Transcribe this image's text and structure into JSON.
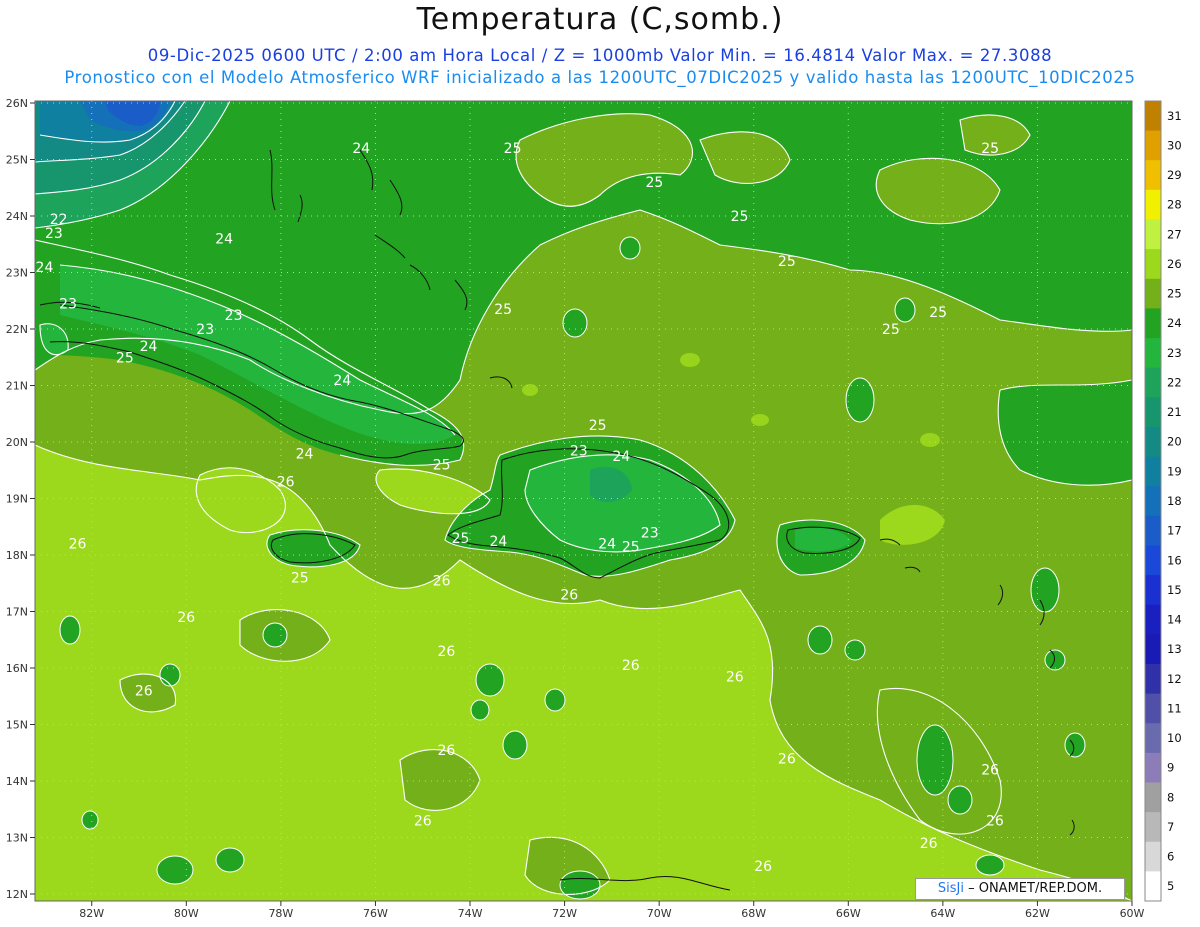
{
  "header": {
    "title": "Temperatura (C,somb.)",
    "line1": "09-Dic-2025  0600 UTC / 2:00 am Hora Local / Z = 1000mb   Valor Min. = 16.4814  Valor Max. = 27.3088",
    "line2": "Pronostico con el Modelo Atmosferico WRF inicializado a las 1200UTC_07DIC2025 y valido hasta las  1200UTC_10DIC2025"
  },
  "axes": {
    "lat_labels": [
      "26N",
      "25N",
      "24N",
      "23N",
      "22N",
      "21N",
      "20N",
      "19N",
      "18N",
      "17N",
      "16N",
      "15N",
      "14N",
      "13N",
      "12N"
    ],
    "lon_labels": [
      "82W",
      "80W",
      "78W",
      "76W",
      "74W",
      "72W",
      "70W",
      "68W",
      "66W",
      "64W",
      "62W",
      "60W"
    ]
  },
  "colorbar": {
    "labels": [
      "31",
      "30",
      "29",
      "28",
      "27",
      "26",
      "25",
      "24",
      "23",
      "22",
      "21",
      "20",
      "19",
      "18",
      "17",
      "16",
      "15",
      "14",
      "13",
      "12",
      "11",
      "10",
      "9",
      "8",
      "7",
      "6",
      "5"
    ],
    "colors": [
      "#c08000",
      "#e0a000",
      "#f0c000",
      "#f0f000",
      "#c0f040",
      "#9cd81c",
      "#74b01a",
      "#22a322",
      "#23b53c",
      "#1ea35a",
      "#17966e",
      "#138b84",
      "#1080a0",
      "#1470b8",
      "#1a5cc8",
      "#1a48d8",
      "#1a30d0",
      "#1a20c0",
      "#1a1ab4",
      "#3030a8",
      "#5050a8",
      "#6a6aae",
      "#8c7cb8",
      "#a0a0a0",
      "#b8b8b8",
      "#d8d8d8",
      "#ffffff"
    ]
  },
  "contour_labels": [
    {
      "text": "24",
      "lon": -76.3,
      "lat": 25.2
    },
    {
      "text": "25",
      "lon": -73.1,
      "lat": 25.2
    },
    {
      "text": "25",
      "lon": -70.1,
      "lat": 24.6
    },
    {
      "text": "25",
      "lon": -68.3,
      "lat": 24.0
    },
    {
      "text": "25",
      "lon": -67.3,
      "lat": 23.2
    },
    {
      "text": "25",
      "lon": -63.0,
      "lat": 25.2
    },
    {
      "text": "25",
      "lon": -65.1,
      "lat": 22.0
    },
    {
      "text": "25",
      "lon": -64.1,
      "lat": 22.3
    },
    {
      "text": "25",
      "lon": -73.3,
      "lat": 22.35
    },
    {
      "text": "22",
      "lon": -82.7,
      "lat": 23.95
    },
    {
      "text": "23",
      "lon": -82.8,
      "lat": 23.7
    },
    {
      "text": "24",
      "lon": -83.0,
      "lat": 23.1
    },
    {
      "text": "24",
      "lon": -79.2,
      "lat": 23.6
    },
    {
      "text": "23",
      "lon": -82.5,
      "lat": 22.45
    },
    {
      "text": "23",
      "lon": -79.6,
      "lat": 22.0
    },
    {
      "text": "23",
      "lon": -79.0,
      "lat": 22.25
    },
    {
      "text": "24",
      "lon": -80.8,
      "lat": 21.7
    },
    {
      "text": "25",
      "lon": -81.3,
      "lat": 21.5
    },
    {
      "text": "24",
      "lon": -76.7,
      "lat": 21.1
    },
    {
      "text": "24",
      "lon": -77.5,
      "lat": 19.8
    },
    {
      "text": "25",
      "lon": -74.6,
      "lat": 19.6
    },
    {
      "text": "25",
      "lon": -71.3,
      "lat": 20.3
    },
    {
      "text": "23",
      "lon": -71.7,
      "lat": 19.85
    },
    {
      "text": "24",
      "lon": -70.8,
      "lat": 19.75
    },
    {
      "text": "26",
      "lon": -77.9,
      "lat": 19.3
    },
    {
      "text": "26",
      "lon": -82.3,
      "lat": 18.2
    },
    {
      "text": "25",
      "lon": -74.2,
      "lat": 18.3
    },
    {
      "text": "24",
      "lon": -73.4,
      "lat": 18.25
    },
    {
      "text": "23",
      "lon": -70.2,
      "lat": 18.4
    },
    {
      "text": "24",
      "lon": -71.1,
      "lat": 18.2
    },
    {
      "text": "25",
      "lon": -70.6,
      "lat": 18.15
    },
    {
      "text": "25",
      "lon": -77.6,
      "lat": 17.6
    },
    {
      "text": "26",
      "lon": -74.6,
      "lat": 17.55
    },
    {
      "text": "26",
      "lon": -71.9,
      "lat": 17.3
    },
    {
      "text": "26",
      "lon": -80.0,
      "lat": 16.9
    },
    {
      "text": "26",
      "lon": -74.5,
      "lat": 16.3
    },
    {
      "text": "26",
      "lon": -70.6,
      "lat": 16.05
    },
    {
      "text": "26",
      "lon": -68.4,
      "lat": 15.85
    },
    {
      "text": "26",
      "lon": -80.9,
      "lat": 15.6
    },
    {
      "text": "26",
      "lon": -74.5,
      "lat": 14.55
    },
    {
      "text": "26",
      "lon": -67.3,
      "lat": 14.4
    },
    {
      "text": "26",
      "lon": -63.0,
      "lat": 14.2
    },
    {
      "text": "26",
      "lon": -62.9,
      "lat": 13.3
    },
    {
      "text": "26",
      "lon": -75.0,
      "lat": 13.3
    },
    {
      "text": "26",
      "lon": -64.3,
      "lat": 12.9
    },
    {
      "text": "26",
      "lon": -67.8,
      "lat": 12.5
    }
  ],
  "credit": {
    "logo": "SisJi",
    "text": "– ONAMET/REP.DOM."
  }
}
